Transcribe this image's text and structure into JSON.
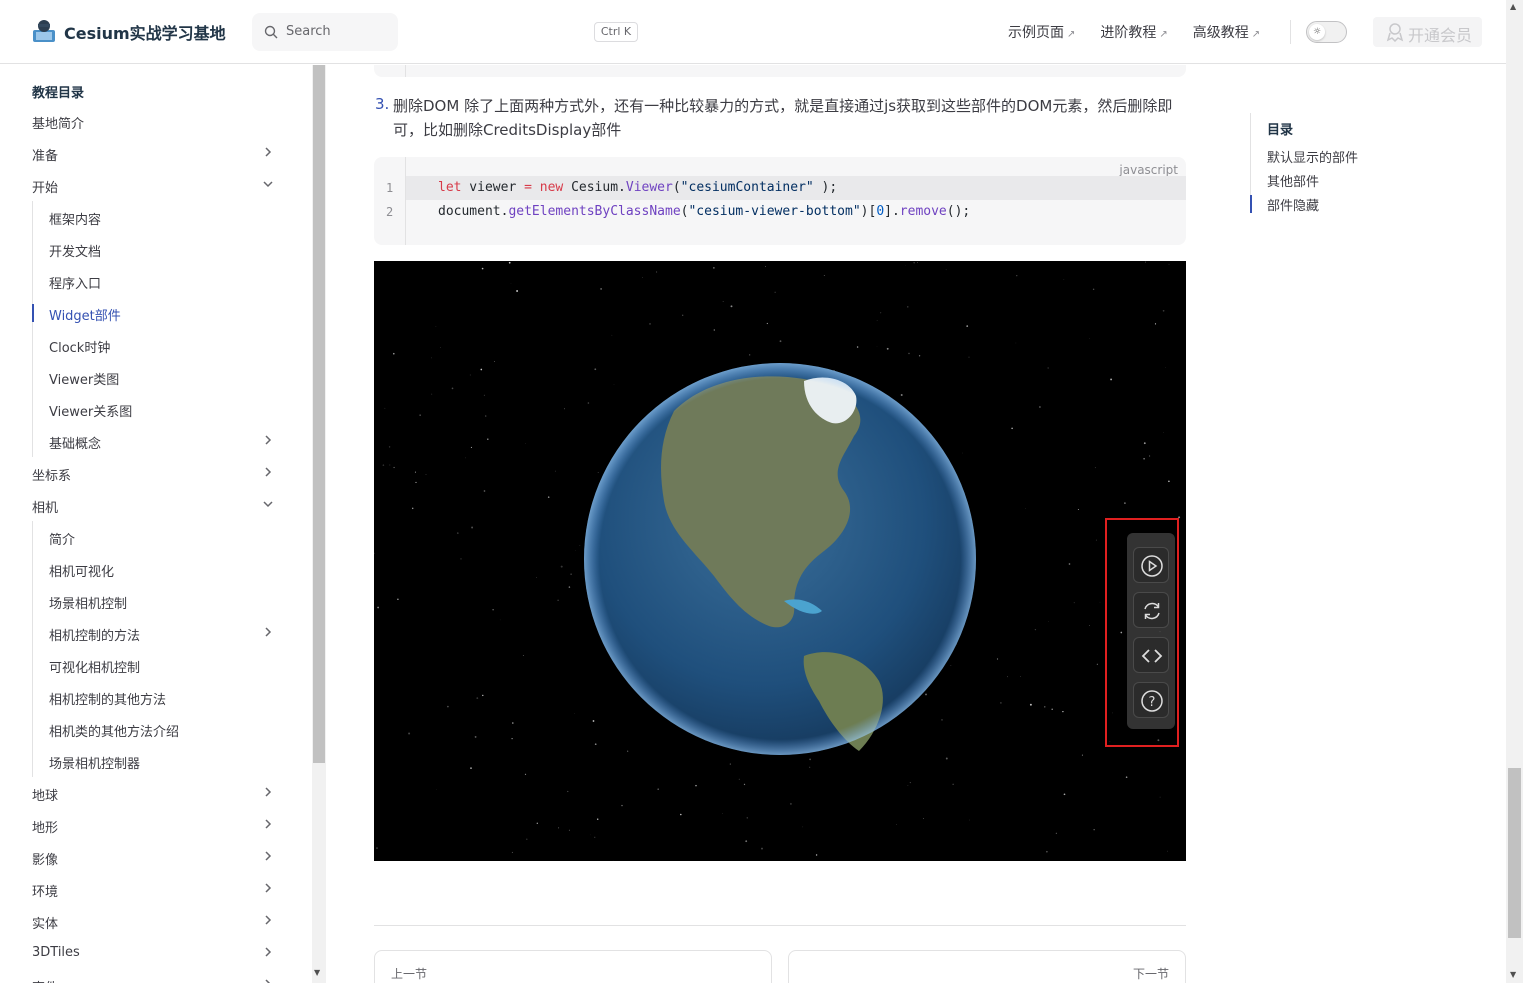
{
  "header": {
    "site_title": "Cesium实战学习基地",
    "search_placeholder": "Search",
    "search_shortcut": "Ctrl K",
    "nav_links": [
      {
        "label": "示例页面",
        "ext": "↗"
      },
      {
        "label": "进阶教程",
        "ext": "↗"
      },
      {
        "label": "高级教程",
        "ext": "↗"
      }
    ],
    "vip_label": "开通会员"
  },
  "sidebar": {
    "title": "教程目录",
    "items": [
      {
        "label": "基地简介",
        "level": 0,
        "chevron": "none"
      },
      {
        "label": "准备",
        "level": 0,
        "chevron": "right"
      },
      {
        "label": "开始",
        "level": 0,
        "chevron": "down"
      },
      {
        "label": "框架内容",
        "level": 1,
        "chevron": "none"
      },
      {
        "label": "开发文档",
        "level": 1,
        "chevron": "none"
      },
      {
        "label": "程序入口",
        "level": 1,
        "chevron": "none"
      },
      {
        "label": "Widget部件",
        "level": 1,
        "chevron": "none",
        "active": true
      },
      {
        "label": "Clock时钟",
        "level": 1,
        "chevron": "none"
      },
      {
        "label": "Viewer类图",
        "level": 1,
        "chevron": "none"
      },
      {
        "label": "Viewer关系图",
        "level": 1,
        "chevron": "none"
      },
      {
        "label": "基础概念",
        "level": 1,
        "chevron": "right"
      },
      {
        "label": "坐标系",
        "level": 0,
        "chevron": "right"
      },
      {
        "label": "相机",
        "level": 0,
        "chevron": "down"
      },
      {
        "label": "简介",
        "level": 1,
        "chevron": "none"
      },
      {
        "label": "相机可视化",
        "level": 1,
        "chevron": "none"
      },
      {
        "label": "场景相机控制",
        "level": 1,
        "chevron": "none"
      },
      {
        "label": "相机控制的方法",
        "level": 1,
        "chevron": "right"
      },
      {
        "label": "可视化相机控制",
        "level": 1,
        "chevron": "none"
      },
      {
        "label": "相机控制的其他方法",
        "level": 1,
        "chevron": "none"
      },
      {
        "label": "相机类的其他方法介绍",
        "level": 1,
        "chevron": "none"
      },
      {
        "label": "场景相机控制器",
        "level": 1,
        "chevron": "none"
      },
      {
        "label": "地球",
        "level": 0,
        "chevron": "right"
      },
      {
        "label": "地形",
        "level": 0,
        "chevron": "right"
      },
      {
        "label": "影像",
        "level": 0,
        "chevron": "right"
      },
      {
        "label": "环境",
        "level": 0,
        "chevron": "right"
      },
      {
        "label": "实体",
        "level": 0,
        "chevron": "right"
      },
      {
        "label": "3DTiles",
        "level": 0,
        "chevron": "right"
      },
      {
        "label": "事件",
        "level": 0,
        "chevron": "right"
      }
    ]
  },
  "content": {
    "step_number": "3.",
    "step_text": "删除DOM 除了上面两种方式外，还有一种比较暴力的方式，就是直接通过js获取到这些部件的DOM元素，然后删除即可，比如删除CreditsDisplay部件",
    "code_lang": "javascript",
    "code_lines": [
      {
        "num": "1"
      },
      {
        "num": "2"
      }
    ],
    "code_tokens": {
      "line1": {
        "kw1": "let",
        "t1": " viewer ",
        "kw2": "=",
        "t2": " ",
        "kw3": "new",
        "t3": " Cesium.",
        "fn1": "Viewer",
        "t4": "(",
        "s1": "\"cesiumContainer\"",
        "t5": " );"
      },
      "line2": {
        "t1": "document.",
        "fn1": "getElementsByClassName",
        "t2": "(",
        "s1": "\"cesium-viewer-bottom\"",
        "t3": ")[",
        "n1": "0",
        "t4": "].",
        "fn2": "remove",
        "t5": "();"
      }
    },
    "viewer_tools": [
      "play-icon",
      "refresh-icon",
      "code-icon",
      "help-icon"
    ],
    "prev_label": "上一节",
    "next_label": "下一节"
  },
  "outline": {
    "title": "目录",
    "items": [
      "默认显示的部件",
      "其他部件",
      "部件隐藏"
    ],
    "active_index": 2
  },
  "colors": {
    "accent": "#3451b2",
    "highlight_box": "#e02020"
  }
}
